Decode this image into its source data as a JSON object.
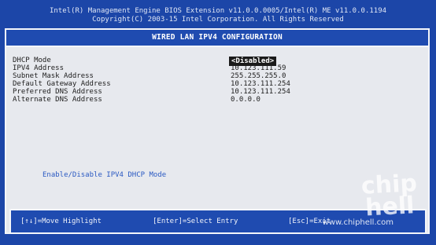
{
  "header": {
    "line1": "Intel(R) Management Engine BIOS Extension v11.0.0.0005/Intel(R) ME v11.0.0.1194",
    "line2": "Copyright(C) 2003-15 Intel Corporation. All Rights Reserved"
  },
  "panel": {
    "title": "WIRED LAN IPV4 CONFIGURATION"
  },
  "settings": [
    {
      "label": "DHCP Mode",
      "value": "<Disabled>"
    },
    {
      "label": "IPV4 Address",
      "value": "10.123.111.59"
    },
    {
      "label": "Subnet Mask Address",
      "value": "255.255.255.0"
    },
    {
      "label": "Default Gateway Address",
      "value": "10.123.111.254"
    },
    {
      "label": "Preferred DNS Address",
      "value": "10.123.111.254"
    },
    {
      "label": "Alternate DNS Address",
      "value": "0.0.0.0"
    }
  ],
  "help_text": "Enable/Disable IPV4 DHCP Mode",
  "footer": {
    "move": "[↑↓]=Move Highlight",
    "select": "[Enter]=Select Entry",
    "exit": "[Esc]=Exit"
  },
  "watermark": {
    "logo": "chip hell",
    "url": "www.chiphell.com"
  },
  "colors": {
    "bios_blue": "#1f4bb0",
    "panel_bg": "#e7e9ee",
    "help_blue": "#2a59c2"
  }
}
